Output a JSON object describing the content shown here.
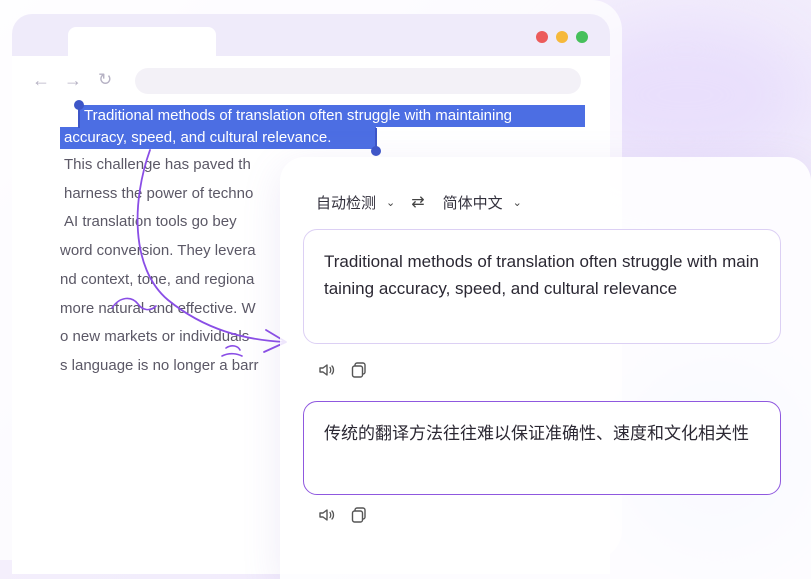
{
  "article": {
    "selected_line1": "Traditional methods of translation often struggle with maintaining",
    "selected_line2": "accuracy, speed, and cultural relevance.",
    "line3": "    This challenge has paved th",
    "line4": " harness the power of techno",
    "line5": "    AI translation tools go bey",
    "line6": "word conversion. They levera",
    "line7": "nd context, tone, and regiona",
    "line8": "more natural and effective. W",
    "line9": "o new markets or individuals",
    "line10": "s language is no longer a barr"
  },
  "translator": {
    "source_language": "自动检测",
    "target_language": "简体中文",
    "source_text": "Traditional methods of translation often struggle with maintaining accuracy, speed, and cultural relevance",
    "translated_text": "传统的翻译方法往往难以保证准确性、速度和文化相关性"
  },
  "icons": {
    "back": "arrow-left-icon",
    "forward": "arrow-right-icon",
    "reload": "reload-icon",
    "swap": "swap-icon",
    "speaker": "speaker-icon",
    "copy": "copy-icon"
  },
  "colors": {
    "selection": "#4c6ee3",
    "accent": "#8f58df",
    "arrow": "#8a4ee6"
  }
}
